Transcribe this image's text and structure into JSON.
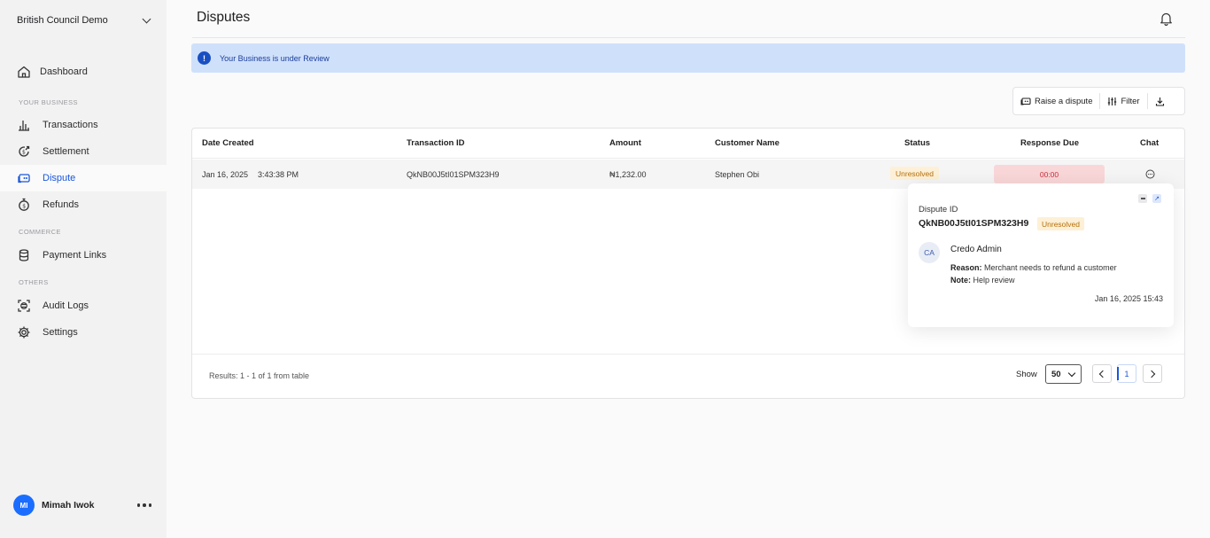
{
  "sidebar": {
    "org_name": "British Council Demo",
    "items": [
      {
        "label": "Dashboard",
        "icon": "home-icon"
      },
      {
        "label": "Transactions",
        "icon": "bar-chart-icon"
      },
      {
        "label": "Settlement",
        "icon": "settlement-icon"
      },
      {
        "label": "Dispute",
        "icon": "dispute-icon",
        "active": true
      },
      {
        "label": "Refunds",
        "icon": "refund-icon"
      },
      {
        "label": "Payment Links",
        "icon": "database-icon"
      },
      {
        "label": "Audit Logs",
        "icon": "audit-icon"
      },
      {
        "label": "Settings",
        "icon": "gear-icon"
      }
    ],
    "sections": {
      "business": "YOUR BUSINESS",
      "commerce": "COMMERCE",
      "others": "OTHERS"
    },
    "user": {
      "initials": "MI",
      "name": "Mimah Iwok"
    }
  },
  "header": {
    "title": "Disputes"
  },
  "banner": {
    "text": "Your Business is under Review",
    "icon": "info-icon"
  },
  "actions": {
    "raise": "Raise a dispute",
    "filter": "Filter"
  },
  "table": {
    "columns": [
      "Date Created",
      "Transaction ID",
      "Amount",
      "Customer Name",
      "Status",
      "Response Due",
      "Chat"
    ],
    "rows": [
      {
        "date": "Jan 16, 2025",
        "time": "3:43:38 PM",
        "txid": "QkNB00J5tI01SPM323H9",
        "amount": "₦1,232.00",
        "customer": "Stephen Obi",
        "status": "Unresolved",
        "due": "00:00"
      }
    ]
  },
  "footer": {
    "results": "Results: 1 - 1 of 1 from table",
    "show_label": "Show",
    "page_size": "50",
    "current_page": "1"
  },
  "popup": {
    "label": "Dispute ID",
    "dispute_id": "QkNB00J5tI01SPM323H9",
    "status": "Unresolved",
    "author_initials": "CA",
    "author": "Credo Admin",
    "reason_label": "Reason:",
    "reason": "Merchant needs to refund a customer",
    "note_label": "Note:",
    "note": "Help review",
    "timestamp": "Jan 16, 2025 15:43"
  },
  "colors": {
    "accent": "#1a56db",
    "banner_bg": "#cfe0fb",
    "warning_bg": "#fdf0d6",
    "danger_bg": "#f9d7d9"
  }
}
